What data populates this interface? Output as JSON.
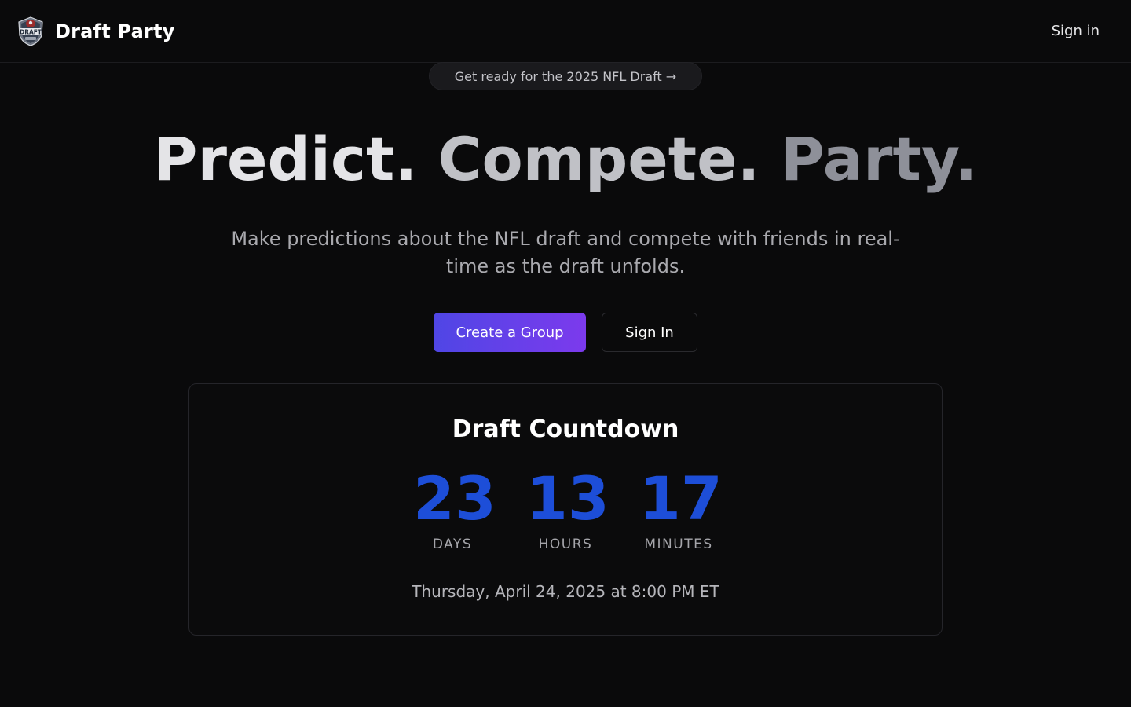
{
  "header": {
    "brand_name": "Draft Party",
    "logo_icon": "draft-shield-logo-icon",
    "sign_in_label": "Sign in"
  },
  "announcement": {
    "label": "Get ready for the 2025 NFL Draft →"
  },
  "hero": {
    "title_words": [
      "Predict.",
      "Compete.",
      "Party."
    ],
    "subtitle": "Make predictions about the NFL draft and compete with friends in real-time as the draft unfolds.",
    "primary_button_label": "Create a Group",
    "secondary_button_label": "Sign In"
  },
  "countdown": {
    "title": "Draft Countdown",
    "units": [
      {
        "value": "23",
        "label": "DAYS"
      },
      {
        "value": "13",
        "label": "HOURS"
      },
      {
        "value": "17",
        "label": "MINUTES"
      }
    ],
    "date_text": "Thursday, April 24, 2025 at 8:00 PM ET"
  },
  "colors": {
    "background": "#0a0a0b",
    "accent_gradient_start": "#4f46e5",
    "accent_gradient_end": "#7c3aed",
    "countdown_number": "#1d4ed8"
  }
}
